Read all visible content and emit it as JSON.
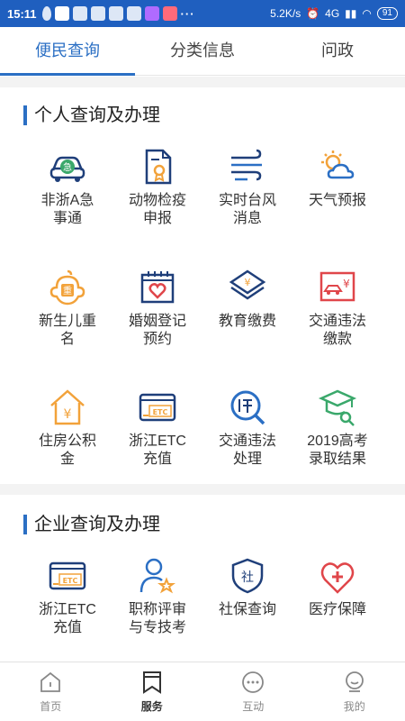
{
  "status_bar": {
    "time": "15:11",
    "speed": "5.2K/s",
    "network": "4G",
    "battery": "91"
  },
  "tabs": [
    {
      "label": "便民查询",
      "active": true
    },
    {
      "label": "分类信息",
      "active": false
    },
    {
      "label": "问政",
      "active": false
    }
  ],
  "sections": {
    "personal": {
      "title": "个人查询及办理",
      "items": [
        {
          "label": "非浙A急\n事通",
          "icon": "car-icon"
        },
        {
          "label": "动物检疫\n申报",
          "icon": "document-icon"
        },
        {
          "label": "实时台风\n消息",
          "icon": "wind-icon"
        },
        {
          "label": "天气预报",
          "icon": "weather-icon"
        },
        {
          "label": "新生儿重\n名",
          "icon": "baby-icon"
        },
        {
          "label": "婚姻登记\n预约",
          "icon": "calendar-heart-icon"
        },
        {
          "label": "教育缴费",
          "icon": "education-icon"
        },
        {
          "label": "交通违法\n缴款",
          "icon": "traffic-fine-icon"
        },
        {
          "label": "住房公积\n金",
          "icon": "house-fund-icon"
        },
        {
          "label": "浙江ETC\n充值",
          "icon": "etc-card-icon"
        },
        {
          "label": "交通违法\n处理",
          "icon": "traffic-handle-icon"
        },
        {
          "label": "2019高考\n录取结果",
          "icon": "graduation-icon"
        }
      ]
    },
    "enterprise": {
      "title": "企业查询及办理",
      "items": [
        {
          "label": "浙江ETC\n充值",
          "icon": "etc-card-icon"
        },
        {
          "label": "职称评审\n与专技考",
          "icon": "person-star-icon"
        },
        {
          "label": "社保查询",
          "icon": "social-security-icon"
        },
        {
          "label": "医疗保障",
          "icon": "medical-heart-icon"
        }
      ]
    }
  },
  "icon_text": {
    "car": "急",
    "baby": "重",
    "yen": "¥",
    "etc": "ETC",
    "she": "社"
  },
  "bottom_nav": [
    {
      "label": "首页",
      "icon": "home-icon",
      "active": false
    },
    {
      "label": "服务",
      "icon": "bookmark-icon",
      "active": true
    },
    {
      "label": "互动",
      "icon": "chat-icon",
      "active": false
    },
    {
      "label": "我的",
      "icon": "profile-icon",
      "active": false
    }
  ],
  "colors": {
    "accent": "#2b6fc4",
    "status_bar": "#1f5fbf",
    "orange": "#f2a23a",
    "red": "#e0464a",
    "green": "#3aa86b",
    "navy": "#1f3f7a"
  }
}
